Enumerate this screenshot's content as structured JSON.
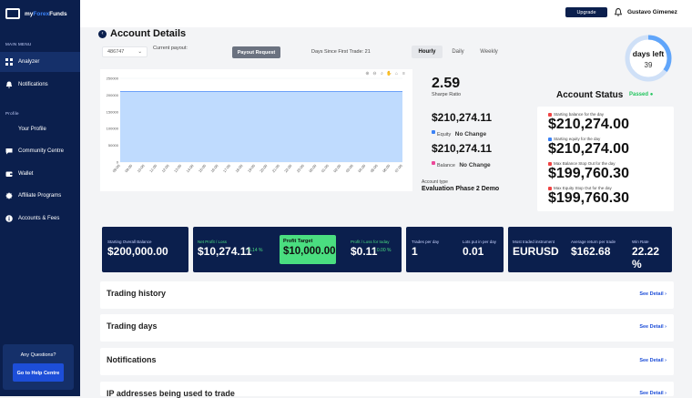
{
  "brand": {
    "name_prefix": "my",
    "name_bold": "Forex",
    "name_suffix": "Funds"
  },
  "sidebar": {
    "main_menu_label": "MAIN MENU",
    "profile_label": "Profile",
    "items": [
      {
        "label": "Analyzer",
        "icon": "grid-icon"
      },
      {
        "label": "Notifications",
        "icon": "bell-icon"
      },
      {
        "label": "Your Profile",
        "icon": "user-icon"
      },
      {
        "label": "Community Centre",
        "icon": "chat-icon"
      },
      {
        "label": "Wallet",
        "icon": "wallet-icon"
      },
      {
        "label": "Affiliate Programs",
        "icon": "badge-icon"
      },
      {
        "label": "Accounts & Fees",
        "icon": "info-icon"
      }
    ],
    "help_question": "Any Questions?",
    "help_button": "Go to Help Centre"
  },
  "topbar": {
    "upgrade": "Upgrade",
    "user_name": "Gustavo Gimenez"
  },
  "page": {
    "title": "Account Details",
    "account_number": "486747",
    "current_payout_label": "Current payout:",
    "payout_button": "Payout Request",
    "days_since_first_trade": "Days Since First Trade: 21",
    "tabs": [
      "Hourly",
      "Daily",
      "Weekly"
    ],
    "active_tab": "Hourly",
    "days_left_label": "days left",
    "days_left_value": "39",
    "days_left_fraction": 0.35
  },
  "chart_data": {
    "type": "area",
    "x": [
      "09:00",
      "09:00",
      "10:00",
      "11:00",
      "12:00",
      "13:00",
      "14:00",
      "15:00",
      "16:00",
      "17:00",
      "18:00",
      "19:00",
      "20:00",
      "21:00",
      "22:00",
      "23:00",
      "00:00",
      "01:00",
      "02:00",
      "03:00",
      "04:00",
      "05:00",
      "06:00",
      "07:00"
    ],
    "series": [
      {
        "values": [
          210274,
          210274,
          210274,
          210274,
          210274,
          210274,
          210274,
          210274,
          210274,
          210274,
          210274,
          210274,
          210274,
          210274,
          210274,
          210274,
          210274,
          210274,
          210274,
          210274,
          210274,
          210274,
          210274,
          210274
        ]
      }
    ],
    "y_ticks": [
      "250000",
      "200000",
      "150000",
      "100000",
      "50000",
      "0"
    ],
    "ylim": [
      0,
      250000
    ],
    "fill_color": "#bfdbfe",
    "line_color": "#3b82f6"
  },
  "metrics": {
    "sharpe_value": "2.59",
    "sharpe_label": "Sharpe Ratio",
    "equity_value": "$210,274.11",
    "equity_label": "Equity",
    "equity_change": "No Change",
    "balance_value": "$210,274.11",
    "balance_label": "Balance",
    "balance_change": "No Change",
    "equity_color": "#3b82f6",
    "balance_color": "#ec4899",
    "account_type_label": "Account type",
    "account_type_value": "Evaluation Phase 2 Demo"
  },
  "status": {
    "title": "Account Status",
    "passed": "Passed",
    "rows": [
      {
        "label": "Starting balance for the day",
        "value": "$210,274.00",
        "color": "#ef4444"
      },
      {
        "label": "Starting equity for the day",
        "value": "$210,274.00",
        "color": "#3b82f6"
      },
      {
        "label": "Max Balance Stop Out for the day",
        "value": "$199,760.30",
        "color": "#ef4444"
      },
      {
        "label": "Max Equity Stop Out for the day",
        "value": "$199,760.30",
        "color": "#ef4444"
      }
    ]
  },
  "kpis": {
    "starting_balance_label": "Starting Overall Balance",
    "starting_balance_value": "$200,000.00",
    "net_profit_label": "Net Profit / Loss",
    "net_profit_value": "$10,274.11",
    "net_profit_pct": "5.14 %",
    "profit_target_label": "Profit Target",
    "profit_target_value": "$10,000.00",
    "today_label": "Profit / Loss for today",
    "today_value": "$0.11",
    "today_pct": "0.00 %",
    "trades_label": "Trades per day",
    "trades_value": "1",
    "lots_label": "Lots put in per day",
    "lots_value": "0.01",
    "instrument_label": "Most traded instrument",
    "instrument_value": "EURUSD",
    "avg_return_label": "Average return per trade",
    "avg_return_value": "$162.68",
    "win_rate_label": "Win Rate",
    "win_rate_value": "22.22 %"
  },
  "sections": [
    {
      "title": "Trading history",
      "link": "See Detail"
    },
    {
      "title": "Trading days",
      "link": "See Detail"
    },
    {
      "title": "Notifications",
      "link": "See Detail"
    },
    {
      "title": "IP addresses being used to trade",
      "link": "See Detail"
    }
  ]
}
